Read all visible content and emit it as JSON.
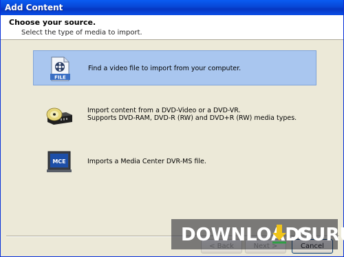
{
  "window": {
    "title": "Add Content"
  },
  "header": {
    "title": "Choose your source.",
    "subtitle": "Select the type of media to import."
  },
  "options": [
    {
      "label": "Find a video file to import from your computer.",
      "icon": "video-file-icon",
      "selected": true
    },
    {
      "label_line1": "Import content from a DVD-Video or a DVD-VR.",
      "label_line2": "Supports DVD-RAM, DVD-R (RW) and DVD+R (RW) media types.",
      "icon": "dvd-drive-icon",
      "selected": false
    },
    {
      "label": "Imports a Media Center DVR-MS file.",
      "icon": "mce-monitor-icon",
      "icon_text": "MCE",
      "selected": false
    }
  ],
  "icon_texts": {
    "file": "FILE"
  },
  "buttons": {
    "back": "< Back",
    "next": "Next >",
    "cancel": "Cancel"
  },
  "watermark": {
    "text_a": "DOWNLOADS",
    "text_b": ".GURU"
  },
  "colors": {
    "titlebar": "#0a5cf2",
    "selection": "#a9c6ef",
    "watermark_arrow": "#f0c419"
  }
}
